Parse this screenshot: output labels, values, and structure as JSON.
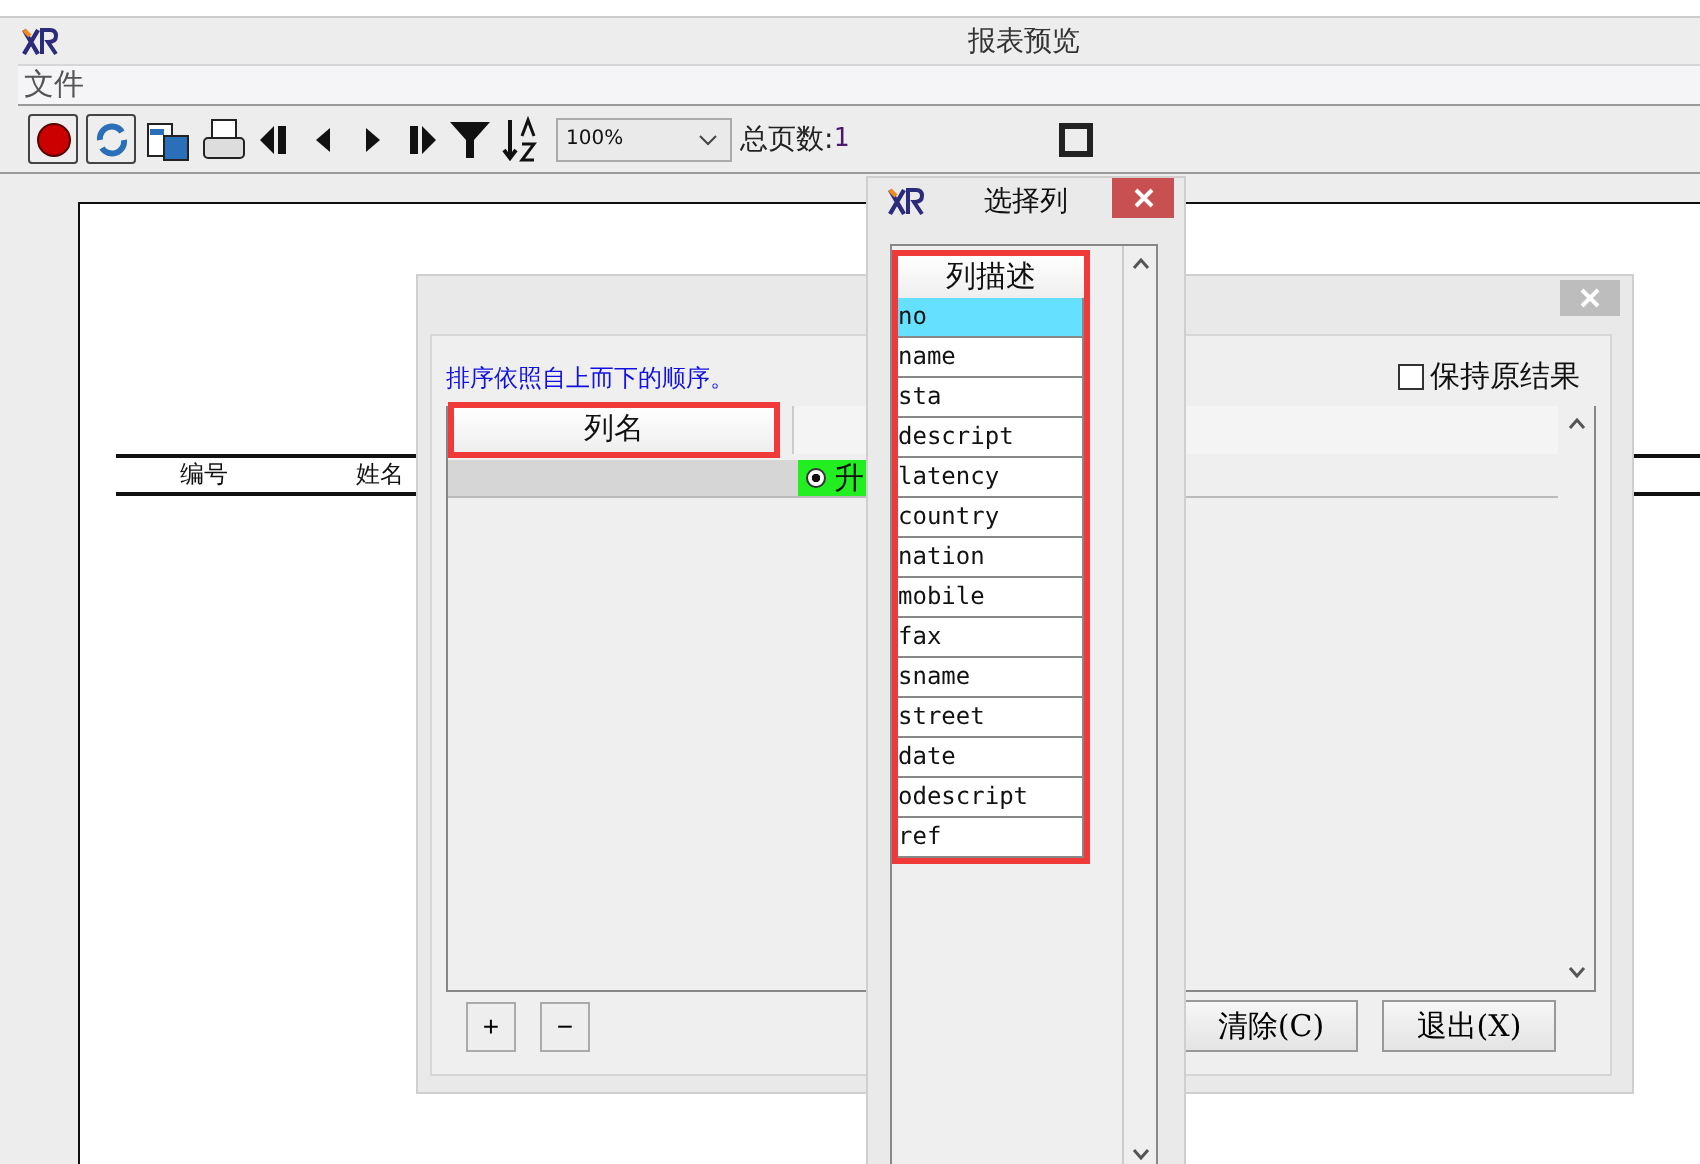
{
  "window": {
    "title": "报表预览"
  },
  "menu": [
    "文件"
  ],
  "toolbar": {
    "zoom": "100%",
    "page_count_label": "总页数:",
    "page_count": "1"
  },
  "report": {
    "columns": [
      "编号",
      "姓名"
    ]
  },
  "sort_dialog": {
    "hint": "排序依照自上而下的顺序。",
    "keep_result": {
      "label": "保持原结果",
      "checked": false
    },
    "columns": [
      "列名"
    ],
    "rows": [
      {
        "order": "升",
        "selected": true
      }
    ],
    "buttons": [
      "+",
      "−"
    ],
    "actions": [
      "清除(C)",
      "退出(X)"
    ]
  },
  "column_picker": {
    "title": "选择列",
    "header": "列描述",
    "items": [
      {
        "label": "no",
        "selected": true
      },
      {
        "label": "name",
        "selected": false
      },
      {
        "label": "sta",
        "selected": false
      },
      {
        "label": "descript",
        "selected": false
      },
      {
        "label": "latency",
        "selected": false
      },
      {
        "label": "country",
        "selected": false
      },
      {
        "label": "nation",
        "selected": false
      },
      {
        "label": "mobile",
        "selected": false
      },
      {
        "label": "fax",
        "selected": false
      },
      {
        "label": "sname",
        "selected": false
      },
      {
        "label": "street",
        "selected": false
      },
      {
        "label": "date",
        "selected": false
      },
      {
        "label": "odescript",
        "selected": false
      },
      {
        "label": "ref",
        "selected": false
      }
    ]
  }
}
